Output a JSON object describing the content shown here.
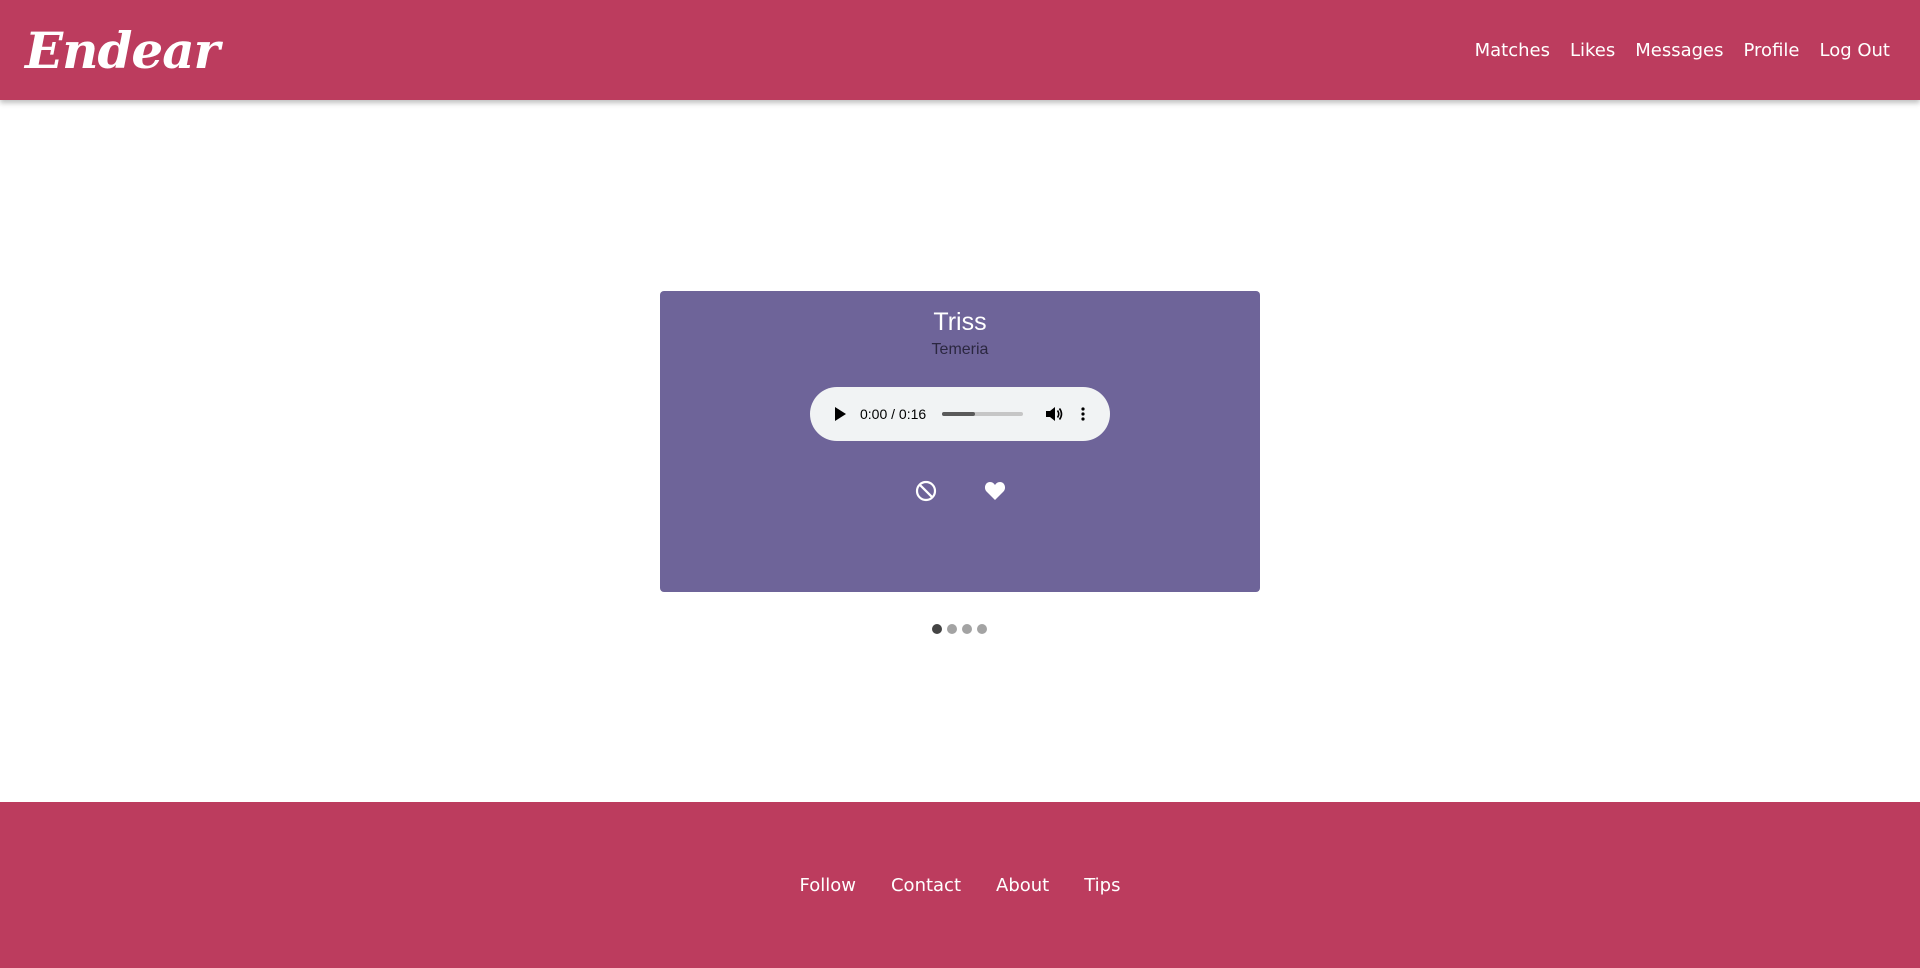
{
  "header": {
    "logo": "Endear",
    "nav": [
      "Matches",
      "Likes",
      "Messages",
      "Profile",
      "Log Out"
    ]
  },
  "card": {
    "name": "Triss",
    "location": "Temeria",
    "audio": {
      "time": "0:00 / 0:16",
      "progress_fraction": 0.41
    },
    "actions": {
      "dislike_icon": "block-icon",
      "like_icon": "heart-icon"
    }
  },
  "pagination": {
    "total": 4,
    "active_index": 0
  },
  "footer": {
    "links": [
      "Follow",
      "Contact",
      "About",
      "Tips"
    ]
  },
  "colors": {
    "brand": "#bc3c5e",
    "card": "#6e6499",
    "audio_bg": "#f1f3f4"
  }
}
